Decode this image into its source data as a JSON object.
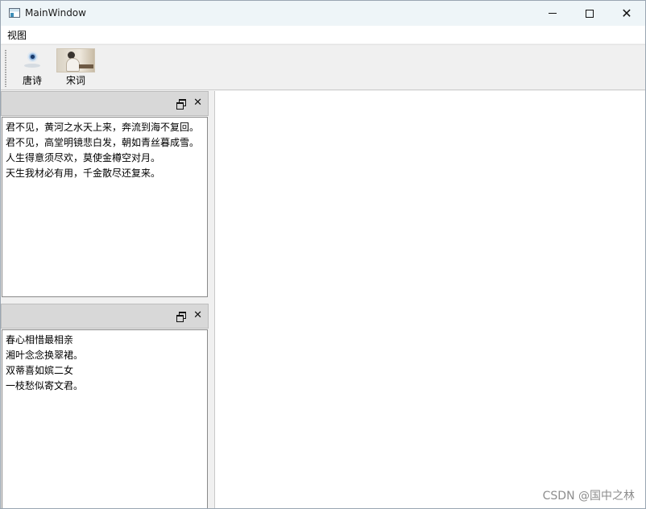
{
  "window": {
    "title": "MainWindow"
  },
  "titlebar_icons": [
    "app-window-icon",
    "minimize-icon",
    "maximize-icon",
    "close-icon"
  ],
  "menubar": {
    "items": [
      {
        "label": "视图"
      }
    ]
  },
  "toolbar": {
    "items": [
      {
        "label": "唐诗",
        "icon": "webcam-icon"
      },
      {
        "label": "宋词",
        "icon": "painting-icon"
      }
    ]
  },
  "docks": [
    {
      "buttons": [
        "float-icon",
        "close-icon"
      ],
      "lines": [
        "君不见，黄河之水天上来，奔流到海不复回。",
        "君不见，高堂明镜悲白发，朝如青丝暮成雪。",
        "人生得意须尽欢，莫使金樽空对月。",
        "天生我材必有用，千金散尽还复来。"
      ]
    },
    {
      "buttons": [
        "float-icon",
        "close-icon"
      ],
      "lines": [
        "春心相惜最相亲",
        "湘叶念念换翠裙。",
        "双蒂喜如嫔二女",
        "一枝愁似寄文君。"
      ]
    }
  ],
  "watermark": "CSDN @国中之林"
}
